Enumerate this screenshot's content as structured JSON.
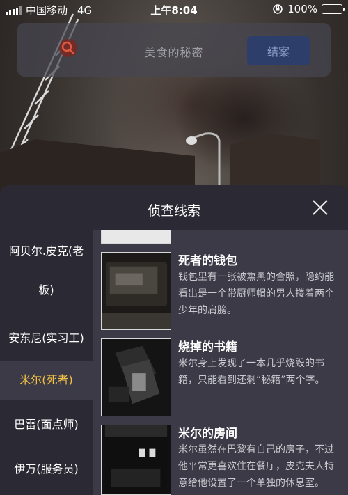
{
  "status_bar": {
    "carrier": "中国移动",
    "network": "4G",
    "time": "上午8:04",
    "battery": "100%"
  },
  "search": {
    "text": "美食的秘密",
    "end_button_label": "结案"
  },
  "panel": {
    "title": "侦查线索",
    "close_icon": "close-icon"
  },
  "sidebar": {
    "items": [
      {
        "label_line1": "阿贝尔.皮克(老",
        "label_line2": "板)"
      },
      {
        "label": "安东尼(实习工)"
      },
      {
        "label": "米尔(死者)",
        "active": true
      },
      {
        "label": "巴雷(面点师)"
      },
      {
        "label": "伊万(服务员)"
      }
    ]
  },
  "clues": [
    {
      "title": "死者的钱包",
      "desc": "钱包里有一张被熏黑的合照，隐约能看出是一个带厨师帽的男人搂着两个少年的肩膀。"
    },
    {
      "title": "烧掉的书籍",
      "desc": "米尔身上发现了一本几乎烧毁的书籍，只能看到还剩“秘籍”两个字。"
    },
    {
      "title": "米尔的房间",
      "desc": "米尔虽然在巴黎有自己的房子，不过他平常更喜欢住在餐厅，皮克夫人特意给他设置了一个单独的休息室。"
    }
  ],
  "colors": {
    "panel_bg": "#2b2a34",
    "content_bg": "#3b3a46",
    "active_text": "#f3c244",
    "end_button_bg": "#2e3e6a"
  }
}
